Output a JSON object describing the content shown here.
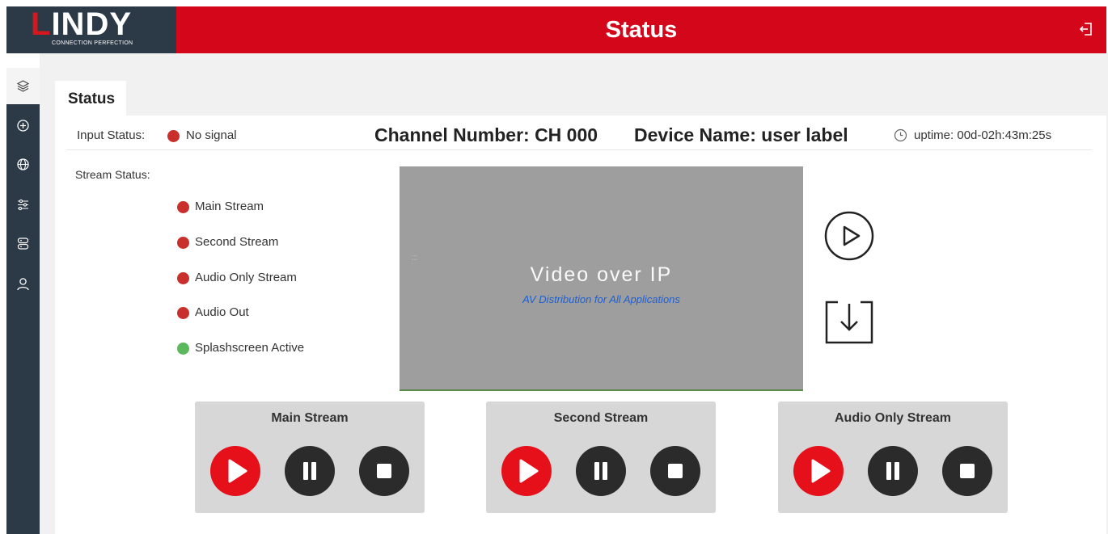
{
  "brand": {
    "name_first": "L",
    "name_rest": "INDY",
    "tagline": "CONNECTION PERFECTION"
  },
  "header": {
    "title": "Status"
  },
  "sidebar": {
    "items": [
      {
        "icon": "layers-icon",
        "active": true
      },
      {
        "icon": "plus-circle-icon",
        "active": false
      },
      {
        "icon": "globe-icon",
        "active": false
      },
      {
        "icon": "sliders-icon",
        "active": false
      },
      {
        "icon": "server-icon",
        "active": false
      },
      {
        "icon": "user-icon",
        "active": false
      }
    ]
  },
  "tabs": [
    {
      "label": "Status"
    }
  ],
  "status": {
    "input_label": "Input Status:",
    "input_value": "No signal",
    "channel": "Channel Number: CH 000",
    "device": "Device Name: user label",
    "uptime": "uptime: 00d-02h:43m:25s",
    "stream_label": "Stream Status:",
    "streams": [
      {
        "label": "Main Stream",
        "color": "#c9302c"
      },
      {
        "label": "Second Stream",
        "color": "#c9302c"
      },
      {
        "label": "Audio Only Stream",
        "color": "#c9302c"
      },
      {
        "label": "Audio Out",
        "color": "#c9302c"
      },
      {
        "label": "Splashscreen Active",
        "color": "#5cb85c"
      }
    ]
  },
  "preview": {
    "title": "Video over IP",
    "subtitle": "AV Distribution for All Applications"
  },
  "controls": [
    {
      "title": "Main Stream"
    },
    {
      "title": "Second Stream"
    },
    {
      "title": "Audio Only Stream"
    }
  ],
  "colors": {
    "brand_red": "#d4061a",
    "nav_dark": "#2c3947",
    "status_red": "#c9302c",
    "status_green": "#5cb85c",
    "play_red": "#e5101a"
  }
}
